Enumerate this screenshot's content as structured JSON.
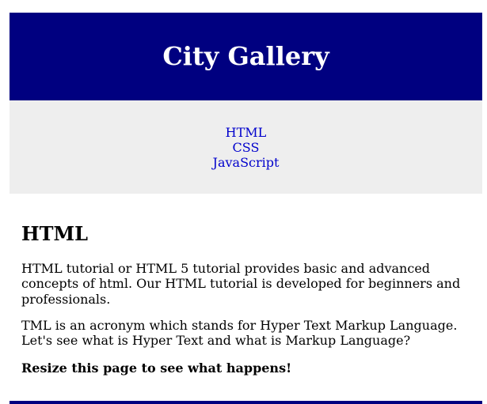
{
  "header": {
    "title": "City Gallery",
    "background_color": "#000080",
    "text_color": "#ffffff"
  },
  "nav": {
    "background_color": "#eeeeee",
    "link_color": "#0000cc",
    "items": [
      {
        "label": "HTML"
      },
      {
        "label": "CSS"
      },
      {
        "label": "JavaScript"
      }
    ]
  },
  "section": {
    "heading": "HTML",
    "paragraphs": [
      "HTML tutorial or HTML 5 tutorial provides basic and advanced concepts of html. Our HTML tutorial is developed for beginners and professionals.",
      "TML is an acronym which stands for Hyper Text Markup Language. Let's see what is Hyper Text and what is Markup Language?"
    ],
    "emphasis": "Resize this page to see what happens!"
  },
  "footer": {
    "background_color": "#000080"
  }
}
